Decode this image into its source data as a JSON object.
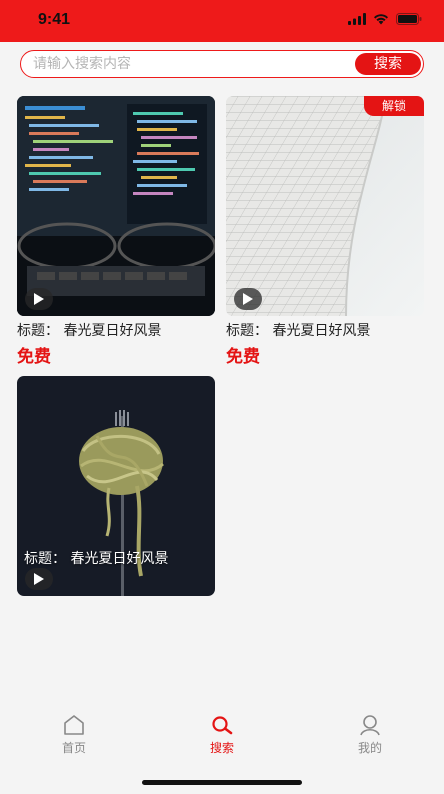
{
  "status_bar": {
    "time": "9:41"
  },
  "search": {
    "placeholder": "请输入搜索内容",
    "value": "",
    "button_label": "搜索"
  },
  "cards": [
    {
      "caption": "标题：  春光夏日好风景",
      "price": "免费",
      "badge": ""
    },
    {
      "caption": "标题：  春光夏日好风景",
      "price": "免费",
      "badge": "解锁"
    },
    {
      "caption": "标题：  春光夏日好风景",
      "price": "",
      "badge": ""
    }
  ],
  "tabs": [
    {
      "label": "首页",
      "icon": "home-icon",
      "active": false
    },
    {
      "label": "搜索",
      "icon": "search-icon",
      "active": true
    },
    {
      "label": "我的",
      "icon": "profile-icon",
      "active": false
    }
  ],
  "colors": {
    "accent": "#e41414",
    "status_bar": "#ee1a1a",
    "background": "#f4f4f4"
  }
}
